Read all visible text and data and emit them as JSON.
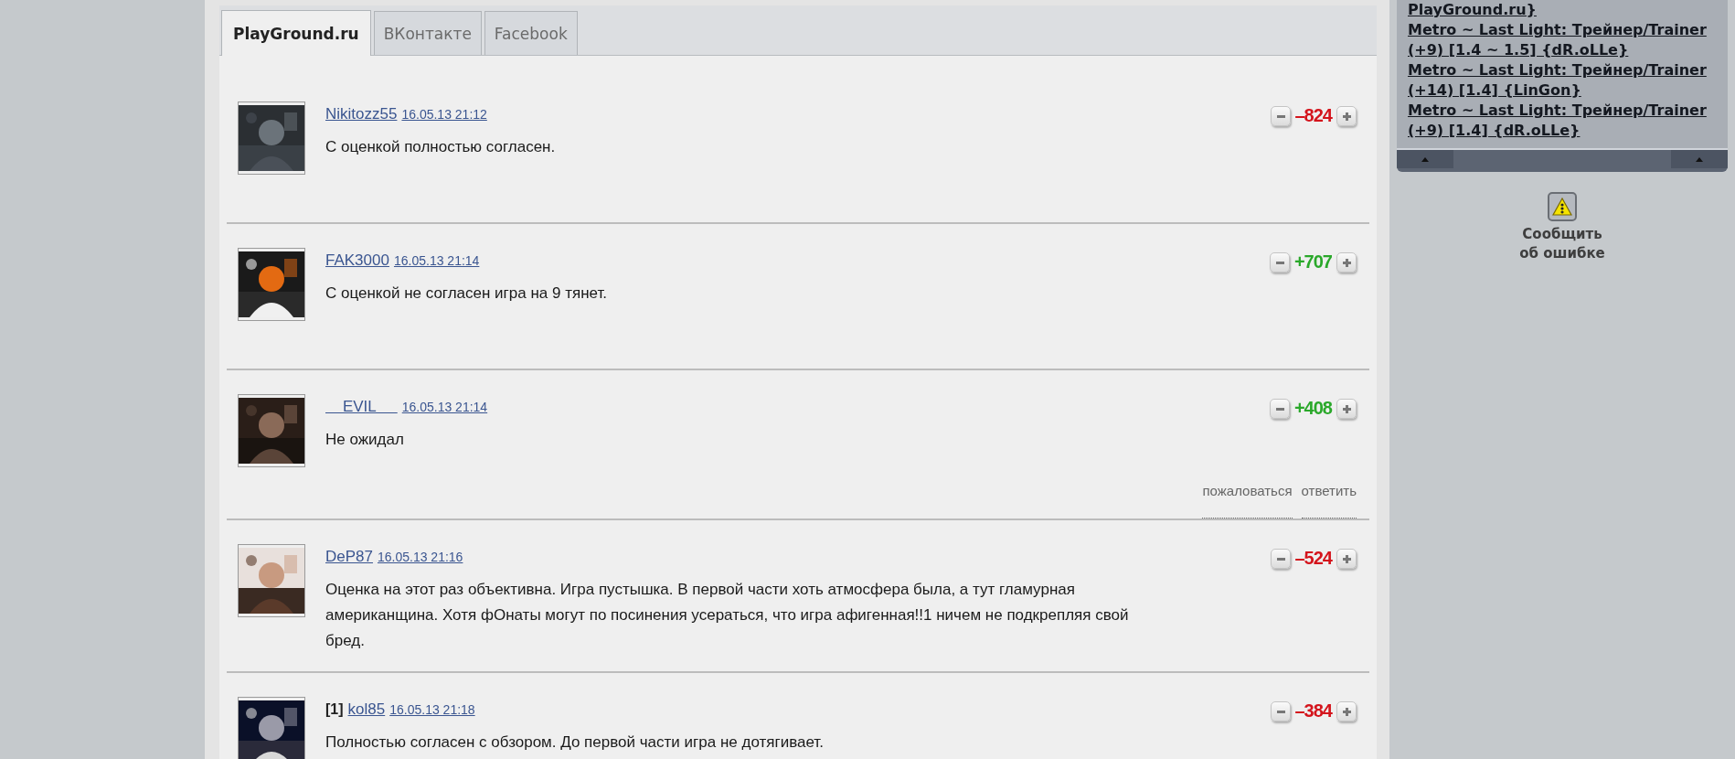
{
  "tabs": [
    {
      "label": "PlayGround.ru",
      "selected": true
    },
    {
      "label": "ВКонтакте",
      "selected": false
    },
    {
      "label": "Facebook",
      "selected": false
    }
  ],
  "comments": [
    {
      "author": "Nikitozz55",
      "date": "16.05.13 21:12",
      "text": "С оценкой полностью согласен.",
      "score": {
        "text": "–824",
        "color": "#d4141c"
      },
      "avatar": {
        "kind": "picture"
      }
    },
    {
      "author": "FAK3000",
      "date": "16.05.13 21:14",
      "text": "С оценкой не согласен игра на 9 тянет.",
      "score": {
        "text": "+707",
        "color": "#2aa82a"
      },
      "avatar": {
        "kind": "picture"
      }
    },
    {
      "author": "    EVIL     ",
      "date": "16.05.13 21:14",
      "text": "Не ожидал",
      "score": {
        "text": "+408",
        "color": "#2aa82a"
      },
      "avatar": {
        "kind": "picture"
      },
      "actions": [
        "пожаловаться",
        "ответить"
      ]
    },
    {
      "author": "DeP87",
      "date": "16.05.13 21:16",
      "text": "Оценка на этот раз объективна. Игра пустышка. В первой части хоть атмосфера была, а тут гламурная американщина. Хотя фОнаты могут по посинения усераться, что игра афигенная!!1 ничем не подкрепляя свой бред.",
      "score": {
        "text": "–524",
        "color": "#d4141c"
      },
      "avatar": {
        "kind": "picture"
      }
    },
    {
      "prefix": "[1]",
      "author": "kol85",
      "date": "16.05.13 21:18",
      "text": "Полностью согласен с обзором. До первой части игра не дотягивает.",
      "score": {
        "text": "–384",
        "color": "#d4141c"
      },
      "avatar": {
        "kind": "picture"
      }
    }
  ],
  "sidebar": {
    "links": [
      "PlayGround.ru}",
      "Metro ~ Last Light: Трейнер/Trainer (+9) [1.4 ~ 1.5] {dR.oLLe}",
      "Metro ~ Last Light: Трейнер/Trainer (+14) [1.4] {LinGon}",
      "Metro ~ Last Light: Трейнер/Trainer (+9) [1.4] {dR.oLLe}"
    ],
    "report": "Сообщить об ошибке"
  }
}
